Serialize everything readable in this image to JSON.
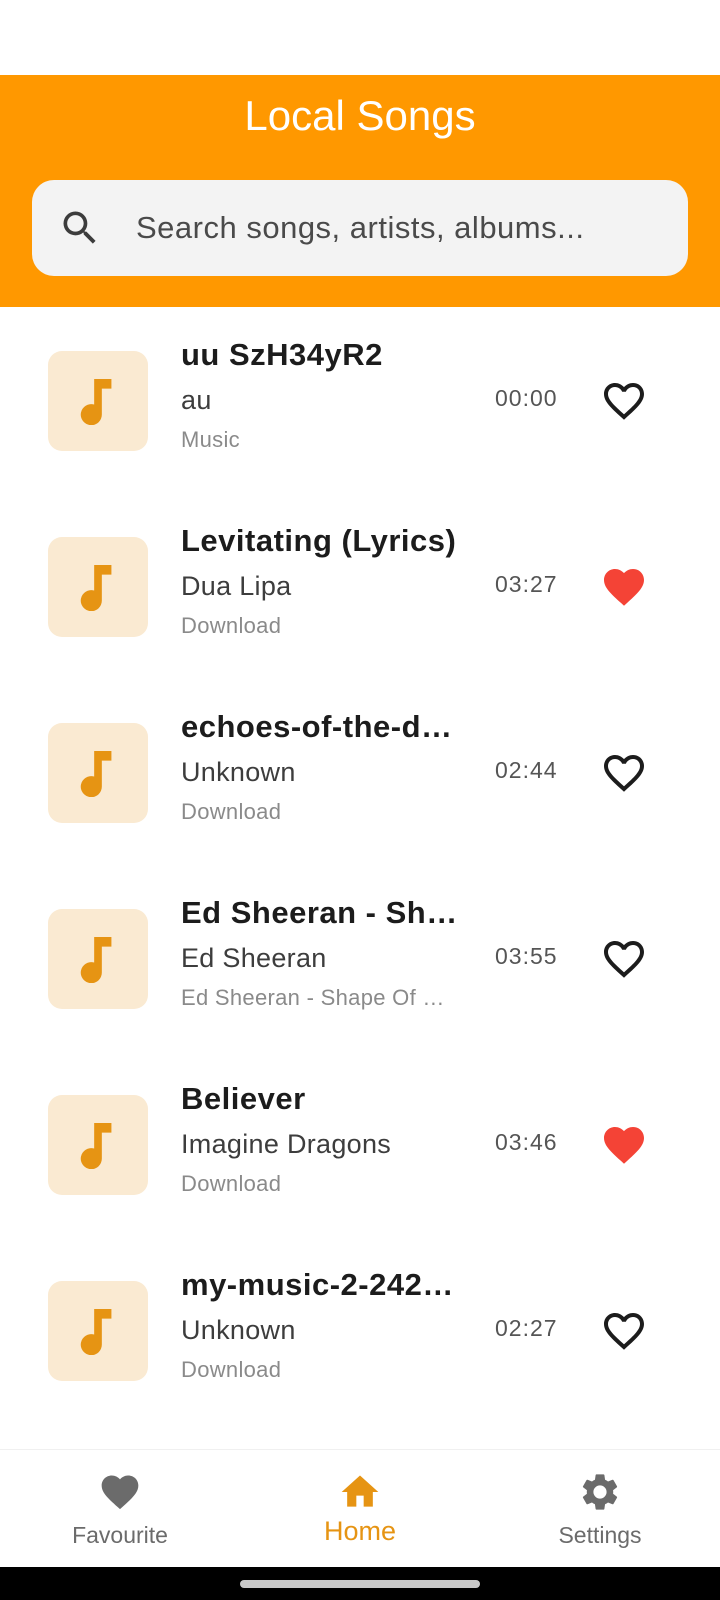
{
  "header": {
    "title": "Local Songs",
    "background_color": "#ff9800"
  },
  "search": {
    "placeholder": "Search songs, artists, albums..."
  },
  "songs": [
    {
      "title": "uu SzH34yR2",
      "artist": "au",
      "album": "Music",
      "duration": "00:00",
      "favourite": false
    },
    {
      "title": "Levitating (Lyrics)",
      "artist": "Dua Lipa",
      "album": "Download",
      "duration": "03:27",
      "favourite": true
    },
    {
      "title": "echoes-of-the-d…",
      "artist": "Unknown",
      "album": "Download",
      "duration": "02:44",
      "favourite": false
    },
    {
      "title": "Ed Sheeran - Sh…",
      "artist": "Ed Sheeran",
      "album": "Ed Sheeran - Shape Of …",
      "duration": "03:55",
      "favourite": false
    },
    {
      "title": "Believer",
      "artist": "Imagine Dragons",
      "album": "Download",
      "duration": "03:46",
      "favourite": true
    },
    {
      "title": "my-music-2-242…",
      "artist": "Unknown",
      "album": "Download",
      "duration": "02:27",
      "favourite": false
    }
  ],
  "bottom_nav": {
    "items": [
      {
        "label": "Favourite",
        "icon": "heart-icon",
        "active": false
      },
      {
        "label": "Home",
        "icon": "home-icon",
        "active": true
      },
      {
        "label": "Settings",
        "icon": "gear-icon",
        "active": false
      }
    ]
  },
  "colors": {
    "accent": "#ff9800",
    "active_nav": "#e69413",
    "favourite": "#f44336",
    "art_background": "#faead2",
    "music_note": "#e69413"
  }
}
